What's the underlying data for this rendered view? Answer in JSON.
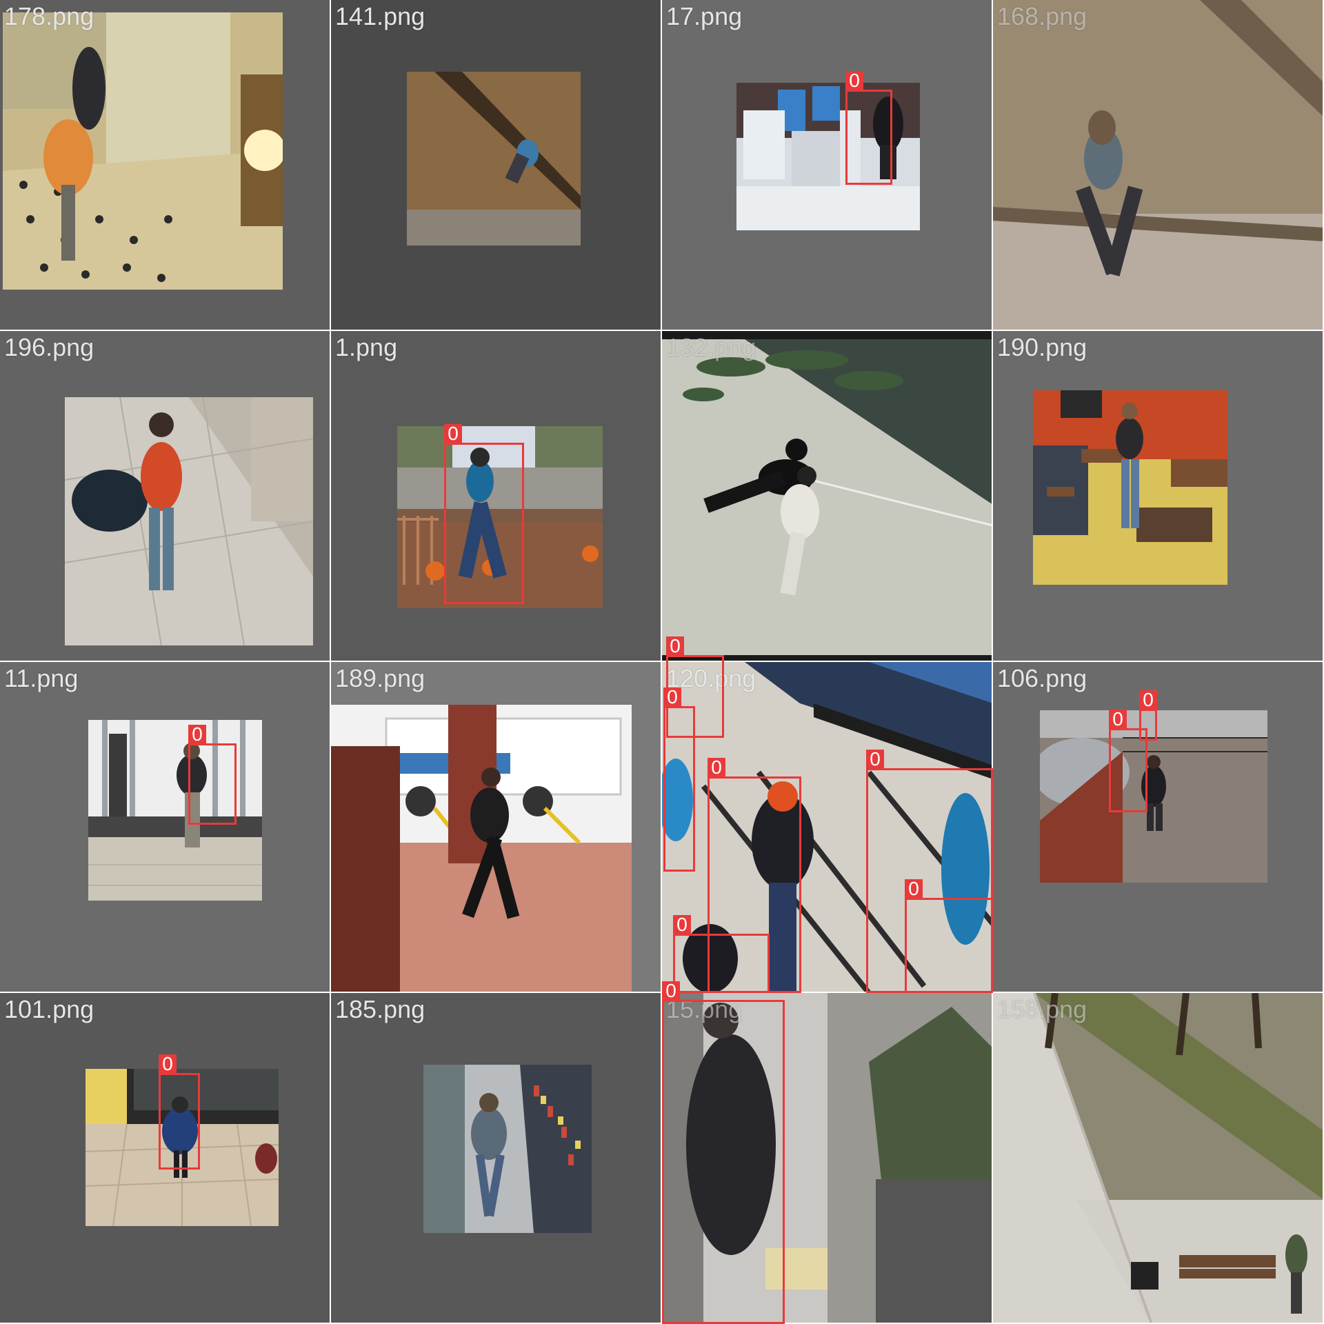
{
  "grid": {
    "tiles": [
      {
        "label": "178.png",
        "detections": []
      },
      {
        "label": "141.png",
        "detections": []
      },
      {
        "label": "17.png",
        "detections": [
          {
            "class_id": "0"
          }
        ]
      },
      {
        "label": "168.png",
        "detections": []
      },
      {
        "label": "196.png",
        "detections": []
      },
      {
        "label": "1.png",
        "detections": [
          {
            "class_id": "0"
          }
        ]
      },
      {
        "label": "132.png",
        "detections": []
      },
      {
        "label": "190.png",
        "detections": []
      },
      {
        "label": "11.png",
        "detections": [
          {
            "class_id": "0"
          }
        ]
      },
      {
        "label": "189.png",
        "detections": []
      },
      {
        "label": "120.png",
        "detections": [
          {
            "class_id": "0"
          },
          {
            "class_id": "0"
          },
          {
            "class_id": "0"
          },
          {
            "class_id": "0"
          },
          {
            "class_id": "0"
          },
          {
            "class_id": "0"
          }
        ]
      },
      {
        "label": "106.png",
        "detections": [
          {
            "class_id": "0"
          },
          {
            "class_id": "0"
          }
        ]
      },
      {
        "label": "101.png",
        "detections": [
          {
            "class_id": "0"
          }
        ]
      },
      {
        "label": "185.png",
        "detections": []
      },
      {
        "label": "15.png",
        "detections": [
          {
            "class_id": "0"
          }
        ]
      },
      {
        "label": "158.png",
        "detections": []
      }
    ]
  },
  "colors": {
    "tile_background": "#585858",
    "tile_background_light": "#6e6e6e",
    "bbox": "#e83a3a",
    "label_text": "#e6e6e6"
  }
}
